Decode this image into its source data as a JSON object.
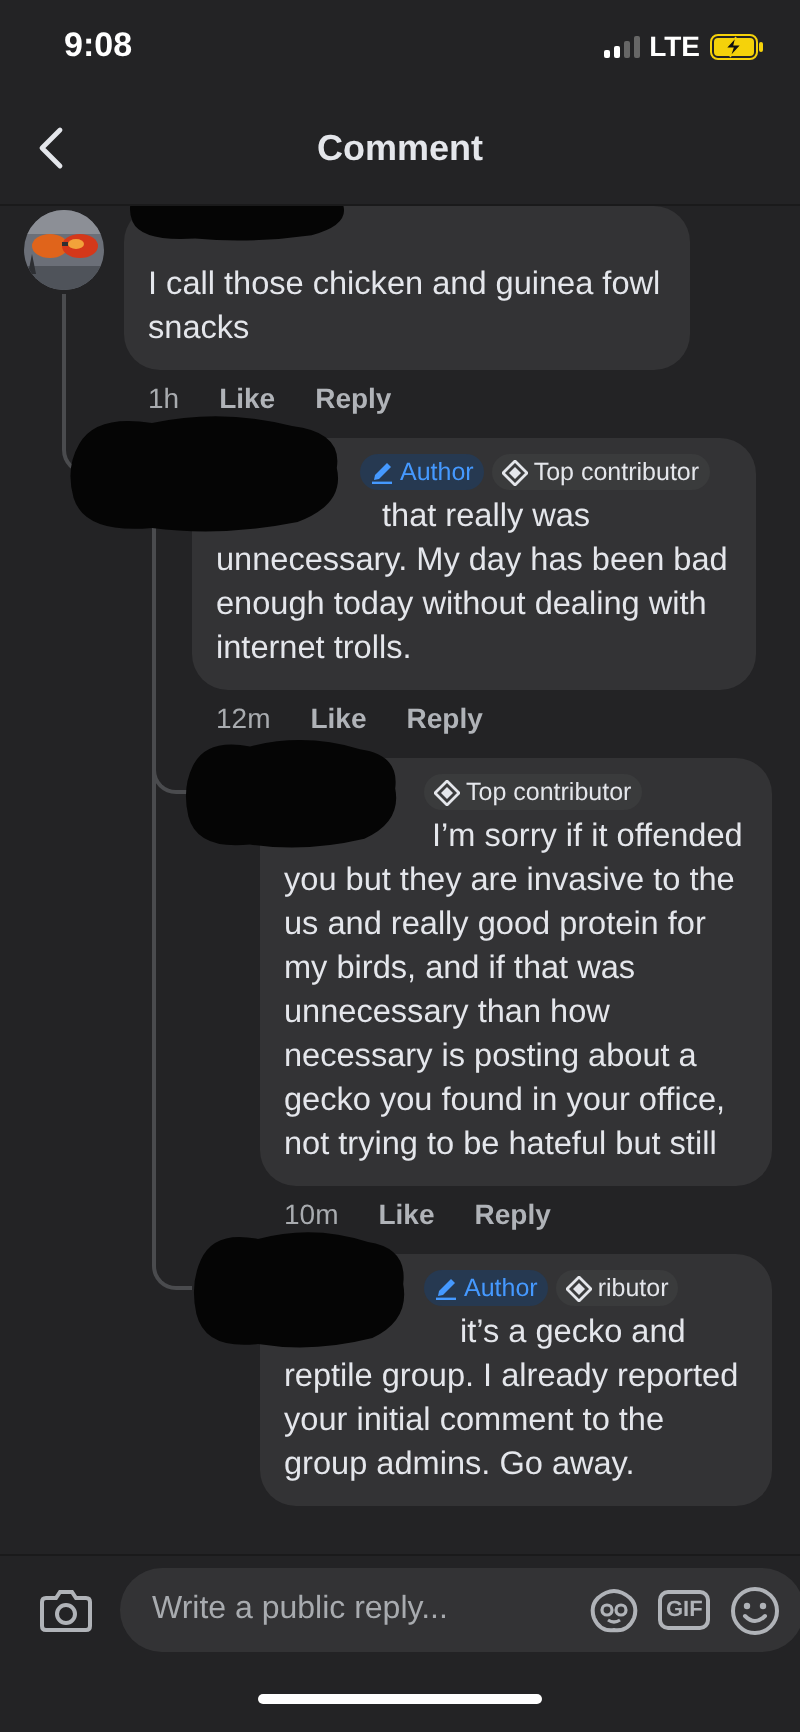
{
  "status_bar": {
    "time": "9:08",
    "network": "LTE"
  },
  "header": {
    "title": "Comment"
  },
  "comments": [
    {
      "redacted": true,
      "avatar": {
        "kind": "picture"
      },
      "text": "I call those chicken and guinea fowl snacks",
      "time": "1h",
      "like": "Like",
      "reply": "Reply",
      "children": [
        {
          "redacted": true,
          "badges": [
            {
              "kind": "author",
              "label": "Author"
            },
            {
              "kind": "top_contributor",
              "label": "Top contributor"
            }
          ],
          "text": "that really was unnecessary. My day has been bad enough today without dealing with internet trolls.",
          "time": "12m",
          "like": "Like",
          "reply": "Reply",
          "children": [
            {
              "redacted": true,
              "badges": [
                {
                  "kind": "top_contributor",
                  "label": "Top contributor"
                }
              ],
              "text": "I’m sorry if it offended you but they are invasive to the us and really good protein for my birds, and if that was unnecessary than how necessary is posting about a gecko you found in your office, not trying to be hateful but still",
              "time": "10m",
              "like": "Like",
              "reply": "Reply"
            },
            {
              "redacted": true,
              "badges": [
                {
                  "kind": "author",
                  "label": "Author"
                },
                {
                  "kind": "top_contributor",
                  "label": "ributor"
                }
              ],
              "text": "it’s a gecko and reptile group. I already reported your initial comment to the group admins. Go away."
            }
          ]
        }
      ]
    }
  ],
  "composer": {
    "placeholder": "Write a public reply...",
    "gif": "GIF"
  }
}
